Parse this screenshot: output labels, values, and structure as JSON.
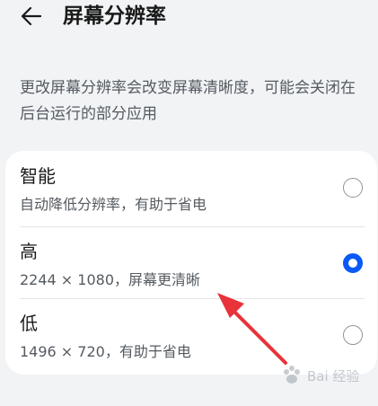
{
  "header": {
    "title": "屏幕分辨率",
    "back_icon": "back-arrow-icon"
  },
  "description": "更改屏幕分辨率会改变屏幕清晰度，可能会关闭在后台运行的部分应用",
  "options": [
    {
      "title": "智能",
      "subtitle": "自动降低分辨率，有助于省电",
      "selected": false
    },
    {
      "title": "高",
      "subtitle": "2244 × 1080，屏幕更清晰",
      "selected": true
    },
    {
      "title": "低",
      "subtitle": "1496 × 720，有助于省电",
      "selected": false
    }
  ],
  "colors": {
    "accent": "#0a59f7",
    "annotation_arrow": "#e8333a",
    "background": "#f1f3f5"
  },
  "watermark": {
    "text": "Bai 经验"
  }
}
